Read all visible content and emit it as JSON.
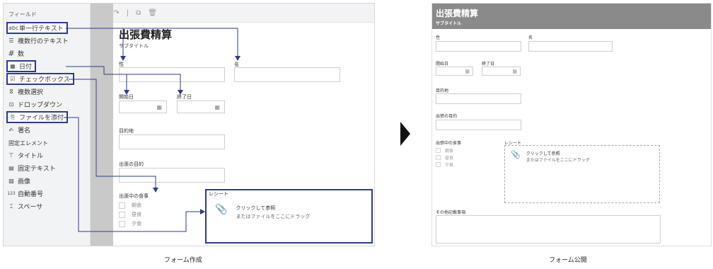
{
  "builder": {
    "sidebar_title": "フィールド",
    "palette": [
      {
        "icon": "abc",
        "label": "単一行テキスト"
      },
      {
        "icon": "☰",
        "label": "複数行のテキスト"
      },
      {
        "icon": "#",
        "label": "数"
      },
      {
        "icon": "▦",
        "label": "日付"
      },
      {
        "icon": "☑",
        "label": "チェックボックス"
      },
      {
        "icon": "ⵓ",
        "label": "複数選択"
      },
      {
        "icon": "⊡",
        "label": "ドロップダウン"
      },
      {
        "icon": "⎘",
        "label": "ファイルを添付"
      },
      {
        "icon": "✍",
        "label": "署名"
      }
    ],
    "fixed_section": "固定エレメント",
    "fixed": [
      {
        "icon": "⊤",
        "label": "タイトル"
      },
      {
        "icon": "▤",
        "label": "固定テキスト"
      },
      {
        "icon": "▨",
        "label": "画像"
      },
      {
        "icon": "123",
        "label": "自動番号"
      },
      {
        "icon": "⌶",
        "label": "スペーサ"
      }
    ],
    "toolbar": {
      "undo": "↶",
      "redo": "↷",
      "sep": "|",
      "copy": "⧉",
      "delete": "🗑"
    },
    "form_title": "出張費精算",
    "form_subtitle": "サブタイトル",
    "labels": {
      "last_name": "性",
      "first_name": "名",
      "start_date": "開始日",
      "end_date": "終了日",
      "destination": "目的地",
      "purpose": "出張の目的",
      "meals": "出張中の食事"
    },
    "meals": [
      "朝食",
      "昼食",
      "夕食"
    ],
    "receipt": {
      "label": "レシート",
      "line1": "クリックして参照",
      "line2": "またはファイルをここにドラッグ"
    },
    "caption": "フォーム作成"
  },
  "published": {
    "title": "出張費精算",
    "subtitle": "サブタイトル",
    "labels": {
      "last_name": "性",
      "first_name": "名",
      "start_date": "開始日",
      "end_date": "終了日",
      "destination": "目的地",
      "purpose": "出張の目的",
      "meals": "出張中の食事",
      "receipt": "レシート",
      "notes": "その他記載事項"
    },
    "meals": [
      "朝食",
      "昼食",
      "夕食"
    ],
    "receipt_line1": "クリックして参照",
    "receipt_line2": "またはファイルをここにドラッグ",
    "caption": "フォーム公開"
  },
  "colors": {
    "highlight": "#2e3a91",
    "header_gray": "#8a8a8a"
  }
}
